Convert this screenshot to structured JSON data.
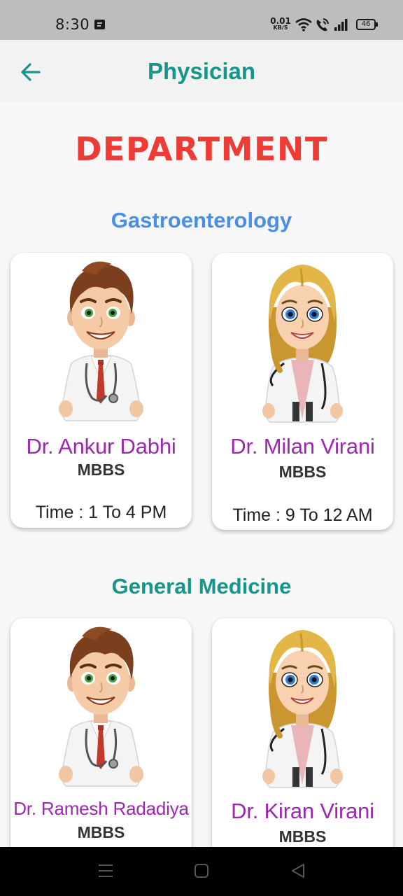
{
  "status_bar": {
    "time": "8:30",
    "speed_value": "0.01",
    "speed_unit": "KB/S",
    "battery": "46",
    "icons": [
      "notification-icon",
      "wifi-icon",
      "volte-call-icon",
      "signal-icon",
      "battery-icon"
    ]
  },
  "app_bar": {
    "title": "Physician",
    "back_icon": "arrow-left-icon",
    "accent_color": "#159688"
  },
  "page": {
    "heading": "DEPARTMENT",
    "heading_color": "#ef3b36"
  },
  "departments": [
    {
      "name": "Gastroenterology",
      "color": "#4a8fe7",
      "doctors": [
        {
          "name": "Dr. Ankur Dabhi",
          "degree": "MBBS",
          "time": "Time : 1 To 4 PM",
          "avatar": "male-doctor-avatar"
        },
        {
          "name": "Dr. Milan Virani",
          "degree": "MBBS",
          "time": "Time : 9 To 12 AM",
          "avatar": "female-doctor-avatar"
        }
      ]
    },
    {
      "name": "General Medicine",
      "color": "#159688",
      "doctors": [
        {
          "name": "Dr. Ramesh Radadiya",
          "degree": "MBBS",
          "avatar": "male-doctor-avatar"
        },
        {
          "name": "Dr. Kiran Virani",
          "degree": "MBBS",
          "avatar": "female-doctor-avatar"
        }
      ]
    }
  ],
  "nav_bar": {
    "buttons": [
      "menu-icon",
      "home-square-icon",
      "back-triangle-icon"
    ]
  }
}
